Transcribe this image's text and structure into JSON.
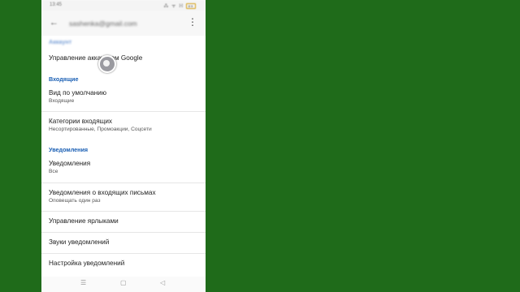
{
  "status_bar": {
    "time": "13:45",
    "signal": "⁂ ᯤ",
    "network": "ℍ",
    "battery": "89"
  },
  "app_bar": {
    "account_email": "sashenka@gmail.com",
    "back_icon": "arrow-back-icon",
    "menu_icon": "more-vert-icon"
  },
  "settings": {
    "top_section_label": "Аккаунт",
    "manage_account": "Управление аккаунтом Google",
    "inbox_header": "Входящие",
    "default_view": {
      "title": "Вид по умолчанию",
      "value": "Входящие"
    },
    "inbox_categories": {
      "title": "Категории входящих",
      "value": "Несортированные, Промоакции, Соцсети"
    },
    "notifications_header": "Уведомления",
    "notifications": {
      "title": "Уведомления",
      "value": "Все"
    },
    "inbox_notifications": {
      "title": "Уведомления о входящих письмах",
      "value": "Оповещать один раз"
    },
    "manage_labels": "Управление ярлыками",
    "notification_sounds": "Звуки уведомлений",
    "notification_settings": "Настройка уведомлений"
  },
  "nav_bar": {
    "menu": "☰",
    "home": "▢",
    "back": "◁"
  }
}
